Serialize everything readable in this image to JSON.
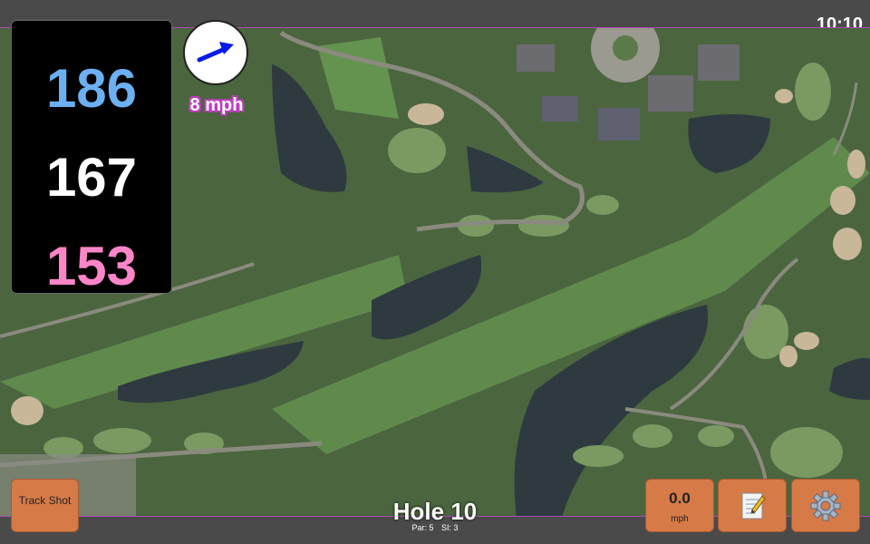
{
  "status": {
    "time": "10:10"
  },
  "distances": {
    "back": "186",
    "middle": "167",
    "front": "153"
  },
  "wind": {
    "speed": "8 mph",
    "direction_icon": "arrow-right-up"
  },
  "buttons": {
    "track_shot": "Track Shot",
    "speed_value": "0.0",
    "speed_unit": "mph",
    "notes_icon": "notepad-icon",
    "settings_icon": "gear-icon"
  },
  "hole": {
    "title": "Hole 10",
    "par": "Par: 5",
    "si": "SI: 3"
  },
  "colors": {
    "back": "#6cb0f2",
    "middle": "#ffffff",
    "front": "#ff85c9",
    "button": "#d67a47",
    "outline": "#c03cc0"
  }
}
